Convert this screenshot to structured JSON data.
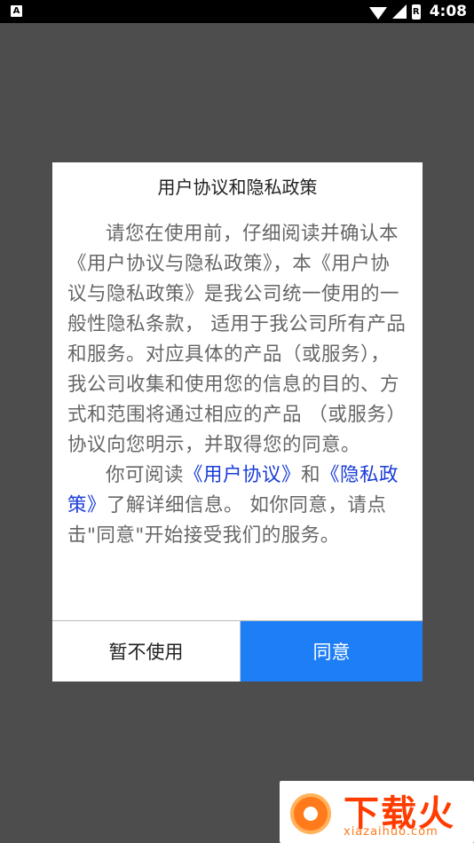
{
  "status_bar": {
    "left_icon": "A",
    "time": "4:08",
    "battery_label": "R"
  },
  "dialog": {
    "title": "用户协议和隐私政策",
    "paragraph1": "请您在使用前，仔细阅读并确认本《用户协议与隐私政策》，本《用户协议与隐私政策》是我公司统一使用的一般性隐私条款， 适用于我公司所有产品和服务。对应具体的产品（或服务），我公司收集和使用您的信息的目的、方式和范围将通过相应的产品 （或服务）协议向您明示，并取得您的同意。",
    "p2_prefix": "你可阅读",
    "link_user_agreement": "《用户协议》",
    "p2_and": "和",
    "link_privacy_policy": "《隐私政策》",
    "p2_suffix": "了解详细信息。 如你同意，请点击\"同意\"开始接受我们的服务。",
    "cancel_label": "暂不使用",
    "agree_label": "同意"
  },
  "watermark": {
    "brand": "下载火",
    "url": "xiazaihuo.com"
  },
  "colors": {
    "overlay": "#4d4d4d",
    "agree_button": "#1e7ef5",
    "link": "#1a3cd6"
  }
}
